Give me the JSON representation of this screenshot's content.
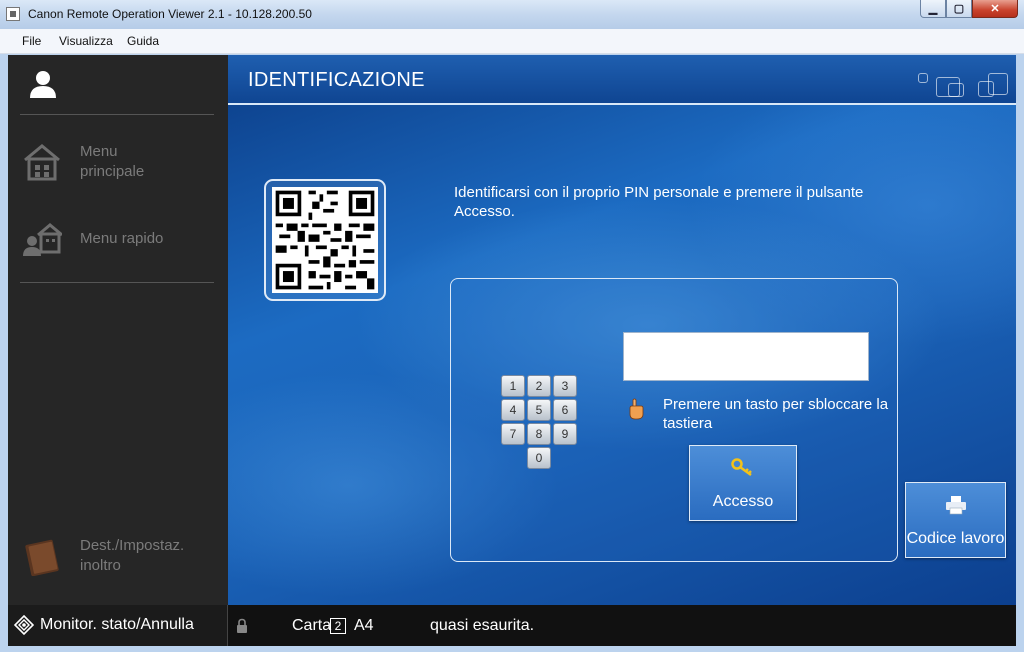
{
  "window": {
    "title": "Canon Remote Operation Viewer 2.1 - 10.128.200.50",
    "controls": {
      "minimize": "▁",
      "maximize": "▢",
      "close": "✕"
    }
  },
  "menubar": {
    "items": [
      "File",
      "Visualizza",
      "Guida"
    ]
  },
  "sidebar": {
    "items": [
      {
        "label": "Menu\nprincipale",
        "icon": "home-icon"
      },
      {
        "label": "Menu rapido",
        "icon": "quick-menu-icon"
      },
      {
        "label": "Dest./Impostaz.\ninoltro",
        "icon": "address-book-icon"
      }
    ]
  },
  "main": {
    "title": "IDENTIFICAZIONE",
    "instructions": "Identificarsi con il proprio PIN personale e premere il pulsante Accesso.",
    "pin_value": "",
    "keypad": [
      "1",
      "2",
      "3",
      "4",
      "5",
      "6",
      "7",
      "8",
      "9",
      "0"
    ],
    "unlock_text": "Premere un tasto per sbloccare la tastiera",
    "access_button": "Accesso",
    "job_code_button": "Codice lavoro"
  },
  "statusbar": {
    "monitor_label": "Monitor. stato/Annulla",
    "paper_label": "Carta",
    "tray": "2",
    "paper_size": "A4",
    "message": "quasi esaurita."
  },
  "colors": {
    "accent": "#1c6bc2",
    "sidebar_bg": "#262626",
    "header_bg": "#0f4592"
  }
}
